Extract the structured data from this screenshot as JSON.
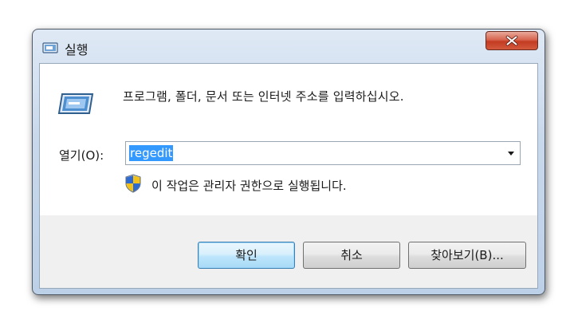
{
  "window": {
    "title": "실행",
    "title_icon": "run-icon",
    "close_icon": "close-icon"
  },
  "description": "프로그램, 폴더, 문서 또는 인터넷 주소를 입력하십시오.",
  "open_field": {
    "label": "열기(O):",
    "value": "regedit",
    "dropdown_icon": "chevron-down-icon"
  },
  "admin_notice": {
    "icon": "uac-shield-icon",
    "text": "이 작업은 관리자 권한으로 실행됩니다."
  },
  "buttons": {
    "ok": "확인",
    "cancel": "취소",
    "browse": "찾아보기(B)..."
  },
  "colors": {
    "selection": "#3399ff",
    "close_button": "#c33c22",
    "default_button_border": "#3c7fb1"
  }
}
